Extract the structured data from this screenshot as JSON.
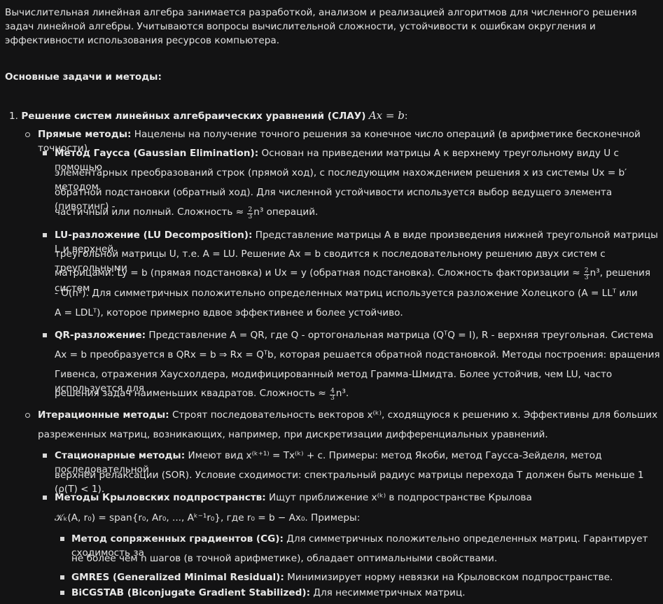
{
  "intro": "Вычислительная линейная алгебра занимается разработкой, анализом и реализацией алгоритмов для численного решения задач линейной алгебры. Учитываются вопросы вычислительной сложности, устойчивости к ошибкам округления и эффективности использования ресурсов компьютера.",
  "section_heading": "Основные задачи и методы:",
  "item1": {
    "number": "1.",
    "title": "Решение систем линейных алгебраических уравнений (СЛАУ)",
    "eq": "Ax = b",
    "colon": ":"
  },
  "direct": {
    "label": "Прямые методы:",
    "text": "Нацелены на получение точного решения за конечное число операций (в арифметике бесконечной точности).",
    "gauss": {
      "label": "Метод Гаусса (Gaussian Elimination):",
      "l1": "Основан на приведении матрицы A к верхнему треугольному виду U с помощью",
      "l2": "элементарных преобразований строк (прямой ход), с последующим нахождением решения x из системы Ux = b′ методом",
      "l3": "обратной подстановки (обратный ход). Для численной устойчивости используется выбор ведущего элемента (пивотинг) -",
      "l4a": "частичный или полный. Сложность ≈",
      "l4b": "n³ операций."
    },
    "lu": {
      "label": "LU-разложение (LU Decomposition):",
      "l1": "Представление матрицы A в виде произведения нижней треугольной матрицы L и верхней",
      "l2": "треугольной матрицы U, т.е. A = LU. Решение Ax = b сводится к последовательному решению двух систем с треугольными",
      "l3a": "матрицами: Ly = b (прямая подстановка) и Ux = y (обратная подстановка). Сложность факторизации ≈",
      "l3b": "n³, решения систем",
      "l4": "- O(n²). Для симметричных положительно определенных матриц используется разложение Холецкого (A = LLᵀ или",
      "l5": "A = LDLᵀ), которое примерно вдвое эффективнее и более устойчиво."
    },
    "qr": {
      "label": "QR-разложение:",
      "l1": "Представление A = QR, где Q - ортогональная матрица (QᵀQ = I), R - верхняя треугольная. Система",
      "l2": "Ax = b преобразуется в QRx = b ⇒ Rx = Qᵀb, которая решается обратной подстановкой. Методы построения: вращения",
      "l3": "Гивенса, отражения Хаусхолдера, модифицированный метод Грамма-Шмидта. Более устойчив, чем LU, часто используется для",
      "l4a": "решения задач наименьших квадратов. Сложность ≈",
      "l4b": "n³."
    }
  },
  "iter": {
    "label": "Итерационные методы:",
    "l1": "Строят последовательность векторов x⁽ᵏ⁾, сходящуюся к решению x. Эффективны для больших",
    "l2": "разреженных матриц, возникающих, например, при дискретизации дифференциальных уравнений.",
    "stat": {
      "label": "Стационарные методы:",
      "l1": "Имеют вид x⁽ᵏ⁺¹⁾ = Tx⁽ᵏ⁾ + c. Примеры: метод Якоби, метод Гаусса-Зейделя, метод последовательной",
      "l2": "верхней релаксации (SOR). Условие сходимости: спектральный радиус матрицы перехода T должен быть меньше 1 (ρ(T) < 1)."
    },
    "krylov": {
      "label": "Методы Крыловских подпространств:",
      "l1": "Ищут приближение x⁽ᵏ⁾ в подпространстве Крылова",
      "l2": "𝒦ₖ(A, r₀) = span{r₀, Ar₀, ..., Aᵏ⁻¹r₀}, где r₀ = b − Ax₀. Примеры:",
      "cg_label": "Метод сопряженных градиентов (CG):",
      "cg_l1": "Для симметричных положительно определенных матриц. Гарантирует сходимость за",
      "cg_l2": "не более чем n шагов (в точной арифметике), обладает оптимальными свойствами.",
      "gmres_label": "GMRES (Generalized Minimal Residual):",
      "gmres_text": "Минимизирует норму невязки на Крыловском подпространстве.",
      "bicg_label": "BiCGSTAB (Biconjugate Gradient Stabilized):",
      "bicg_text": "Для несимметричных матриц."
    }
  },
  "frac": {
    "two": "2",
    "three": "3",
    "four": "4"
  },
  "colors": {
    "background": "#131314",
    "text": "#e3e3e3"
  }
}
